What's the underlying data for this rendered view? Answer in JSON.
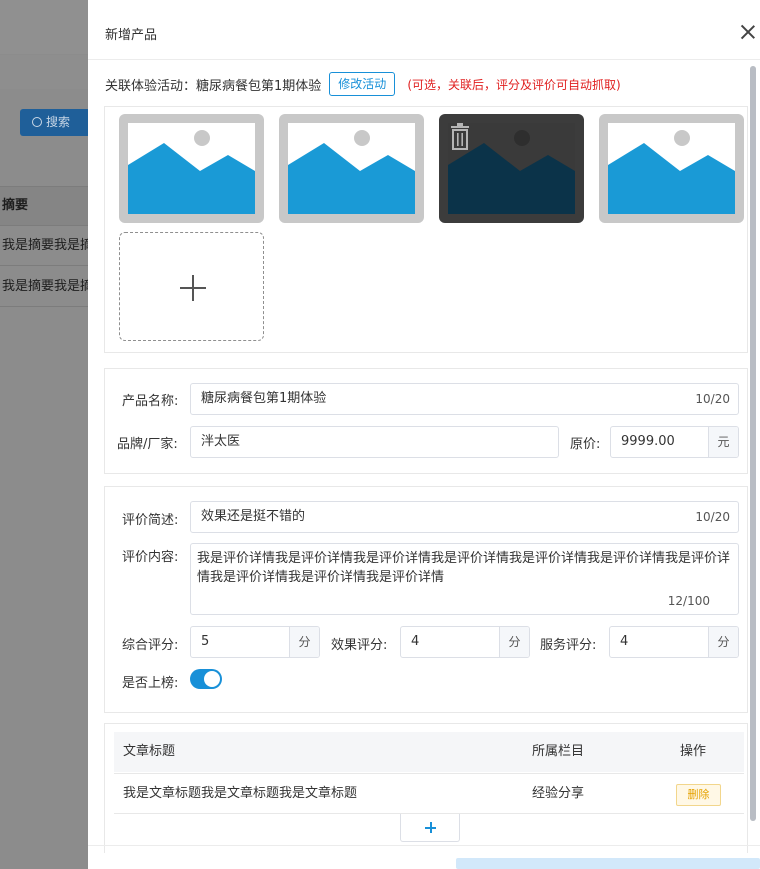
{
  "background": {
    "search_button": "搜索",
    "table_header": "摘要",
    "rows": [
      "我是摘要我是摘要我是摘要",
      "我是摘要我是摘要我是摘要"
    ]
  },
  "drawer": {
    "title": "新增产品",
    "activity": {
      "label": "关联体验活动：",
      "value": "糖尿病餐包第1期体验",
      "modify_button": "修改活动",
      "note": "(可选，关联后，评分及评价可自动抓取)"
    },
    "product": {
      "name_label": "产品名称:",
      "name_value": "糖尿病餐包第1期体验",
      "name_counter": "10/20",
      "brand_label": "品牌/厂家:",
      "brand_value": "泮太医",
      "price_label": "原价:",
      "price_value": "9999.00",
      "price_unit": "元"
    },
    "review": {
      "summary_label": "评价简述:",
      "summary_value": "效果还是挺不错的",
      "summary_counter": "10/20",
      "content_label": "评价内容:",
      "content_value": "我是评价详情我是评价详情我是评价详情我是评价详情我是评价详情我是评价详情我是评价详情我是评价详情我是评价详情我是评价详情",
      "content_counter": "12/100",
      "overall_label": "综合评分:",
      "overall_value": "5",
      "effect_label": "效果评分:",
      "effect_value": "4",
      "service_label": "服务评分:",
      "service_value": "4",
      "score_unit": "分",
      "ranking_label": "是否上榜:",
      "ranking_on": true
    },
    "articles": {
      "headers": [
        "文章标题",
        "所属栏目",
        "操作"
      ],
      "rows": [
        {
          "title": "我是文章标题我是文章标题我是文章标题",
          "column": "经验分享",
          "action": "删除"
        }
      ]
    }
  },
  "colors": {
    "primary": "#1890d8",
    "danger_text": "#e02020",
    "warning": "#e5a100",
    "image_blue": "#1a9ad6"
  },
  "icons": [
    "close-icon",
    "trash-icon",
    "plus-icon",
    "image-placeholder-icon",
    "search-icon"
  ]
}
